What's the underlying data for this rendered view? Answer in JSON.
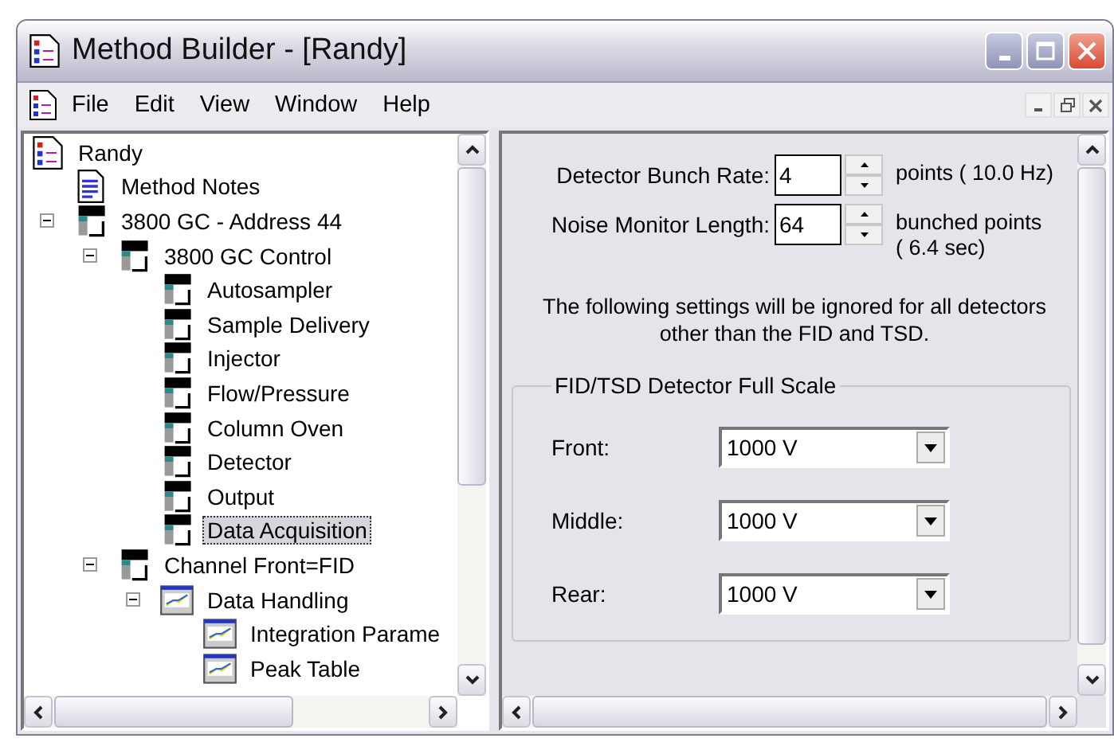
{
  "window": {
    "title": "Method Builder - [Randy]"
  },
  "menu": [
    "File",
    "Edit",
    "View",
    "Window",
    "Help"
  ],
  "tree": [
    {
      "label": "Randy",
      "kind": "method",
      "selected": false,
      "children": [
        {
          "label": "Method Notes",
          "kind": "notes",
          "selected": false
        },
        {
          "label": "3800 GC - Address 44",
          "kind": "instrument",
          "selected": false,
          "expanded": true,
          "children": [
            {
              "label": "3800 GC Control",
              "kind": "instrument",
              "selected": false,
              "expanded": true,
              "children": [
                {
                  "label": "Autosampler",
                  "kind": "instrument",
                  "selected": false
                },
                {
                  "label": "Sample Delivery",
                  "kind": "instrument",
                  "selected": false
                },
                {
                  "label": "Injector",
                  "kind": "instrument",
                  "selected": false
                },
                {
                  "label": "Flow/Pressure",
                  "kind": "instrument",
                  "selected": false
                },
                {
                  "label": "Column Oven",
                  "kind": "instrument",
                  "selected": false
                },
                {
                  "label": "Detector",
                  "kind": "instrument",
                  "selected": false
                },
                {
                  "label": "Output",
                  "kind": "instrument",
                  "selected": false
                },
                {
                  "label": "Data Acquisition",
                  "kind": "instrument",
                  "selected": true
                }
              ]
            },
            {
              "label": "Channel Front=FID",
              "kind": "instrument",
              "selected": false,
              "expanded": true,
              "children": [
                {
                  "label": "Data Handling",
                  "kind": "data",
                  "selected": false,
                  "expanded": true,
                  "children": [
                    {
                      "label": "Integration Parame",
                      "kind": "data",
                      "selected": false
                    },
                    {
                      "label": "Peak Table",
                      "kind": "data",
                      "selected": false
                    }
                  ]
                }
              ]
            }
          ]
        }
      ]
    }
  ],
  "fields": [
    {
      "label": "Detector Bunch Rate:",
      "value": "4",
      "unit": [
        "points ( 10.0 Hz)"
      ]
    },
    {
      "label": "Noise Monitor Length:",
      "value": "64",
      "unit": [
        "bunched points",
        "( 6.4 sec)"
      ]
    }
  ],
  "note": "The following settings will be ignored for all detectors other than the FID and TSD.",
  "group": {
    "title": "FID/TSD Detector Full Scale",
    "rows": [
      {
        "label": "Front:",
        "value": "1000 V"
      },
      {
        "label": "Middle:",
        "value": "1000 V"
      },
      {
        "label": "Rear:",
        "value": "1000 V"
      }
    ]
  }
}
